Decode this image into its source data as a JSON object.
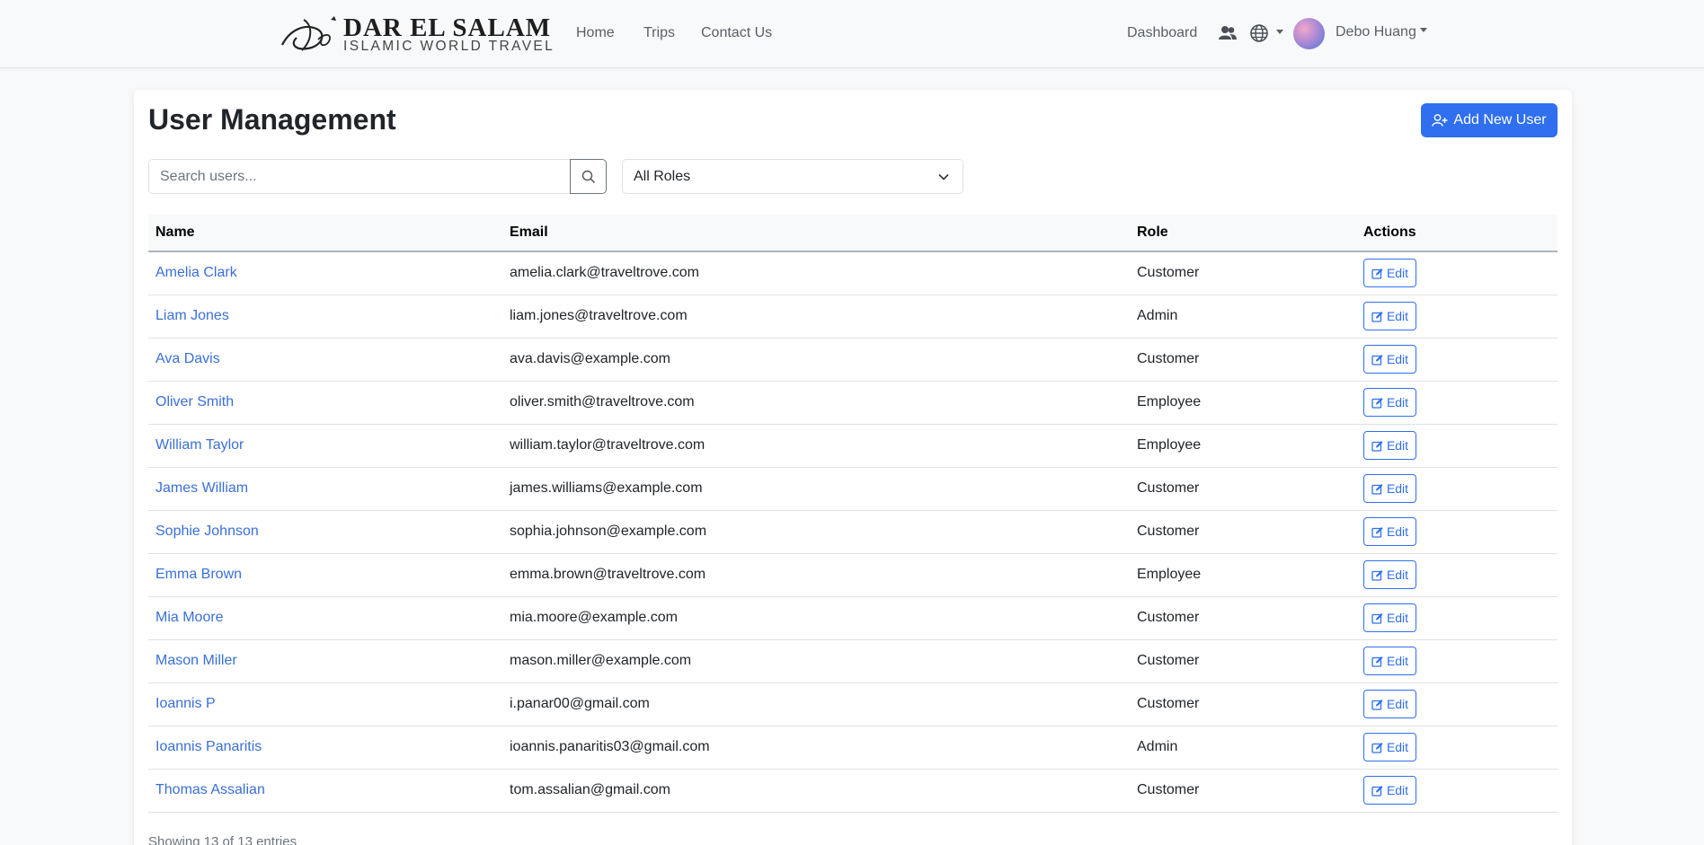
{
  "brand": {
    "title": "DAR EL SALAM",
    "subtitle": "ISLAMIC WORLD TRAVEL"
  },
  "nav": {
    "links": [
      "Home",
      "Trips",
      "Contact Us"
    ],
    "dashboard": "Dashboard",
    "user_name": "Debo Huang",
    "icons": [
      "users-icon",
      "globe-icon"
    ]
  },
  "page": {
    "title": "User Management",
    "add_button": "Add New User"
  },
  "search": {
    "placeholder": "Search users...",
    "value": ""
  },
  "role_filter": {
    "selected": "All Roles"
  },
  "table": {
    "headers": [
      "Name",
      "Email",
      "Role",
      "Actions"
    ],
    "edit_label": "Edit",
    "rows": [
      {
        "name": "Amelia Clark",
        "email": "amelia.clark@traveltrove.com",
        "role": "Customer"
      },
      {
        "name": "Liam Jones",
        "email": "liam.jones@traveltrove.com",
        "role": "Admin"
      },
      {
        "name": "Ava Davis",
        "email": "ava.davis@example.com",
        "role": "Customer"
      },
      {
        "name": "Oliver Smith",
        "email": "oliver.smith@traveltrove.com",
        "role": "Employee"
      },
      {
        "name": "William Taylor",
        "email": "william.taylor@traveltrove.com",
        "role": "Employee"
      },
      {
        "name": "James William",
        "email": "james.williams@example.com",
        "role": "Customer"
      },
      {
        "name": "Sophie Johnson",
        "email": "sophia.johnson@example.com",
        "role": "Customer"
      },
      {
        "name": "Emma Brown",
        "email": "emma.brown@traveltrove.com",
        "role": "Employee"
      },
      {
        "name": "Mia Moore",
        "email": "mia.moore@example.com",
        "role": "Customer"
      },
      {
        "name": "Mason Miller",
        "email": "mason.miller@example.com",
        "role": "Customer"
      },
      {
        "name": "Ioannis P",
        "email": "i.panar00@gmail.com",
        "role": "Customer"
      },
      {
        "name": "Ioannis Panaritis",
        "email": "ioannis.panaritis03@gmail.com",
        "role": "Admin"
      },
      {
        "name": "Thomas Assalian",
        "email": "tom.assalian@gmail.com",
        "role": "Customer"
      }
    ]
  },
  "footer": {
    "info": "Showing 13 of 13 entries"
  },
  "colors": {
    "primary": "#2f6ff0",
    "link": "#3a6fd8",
    "background": "#f8f9fa"
  }
}
